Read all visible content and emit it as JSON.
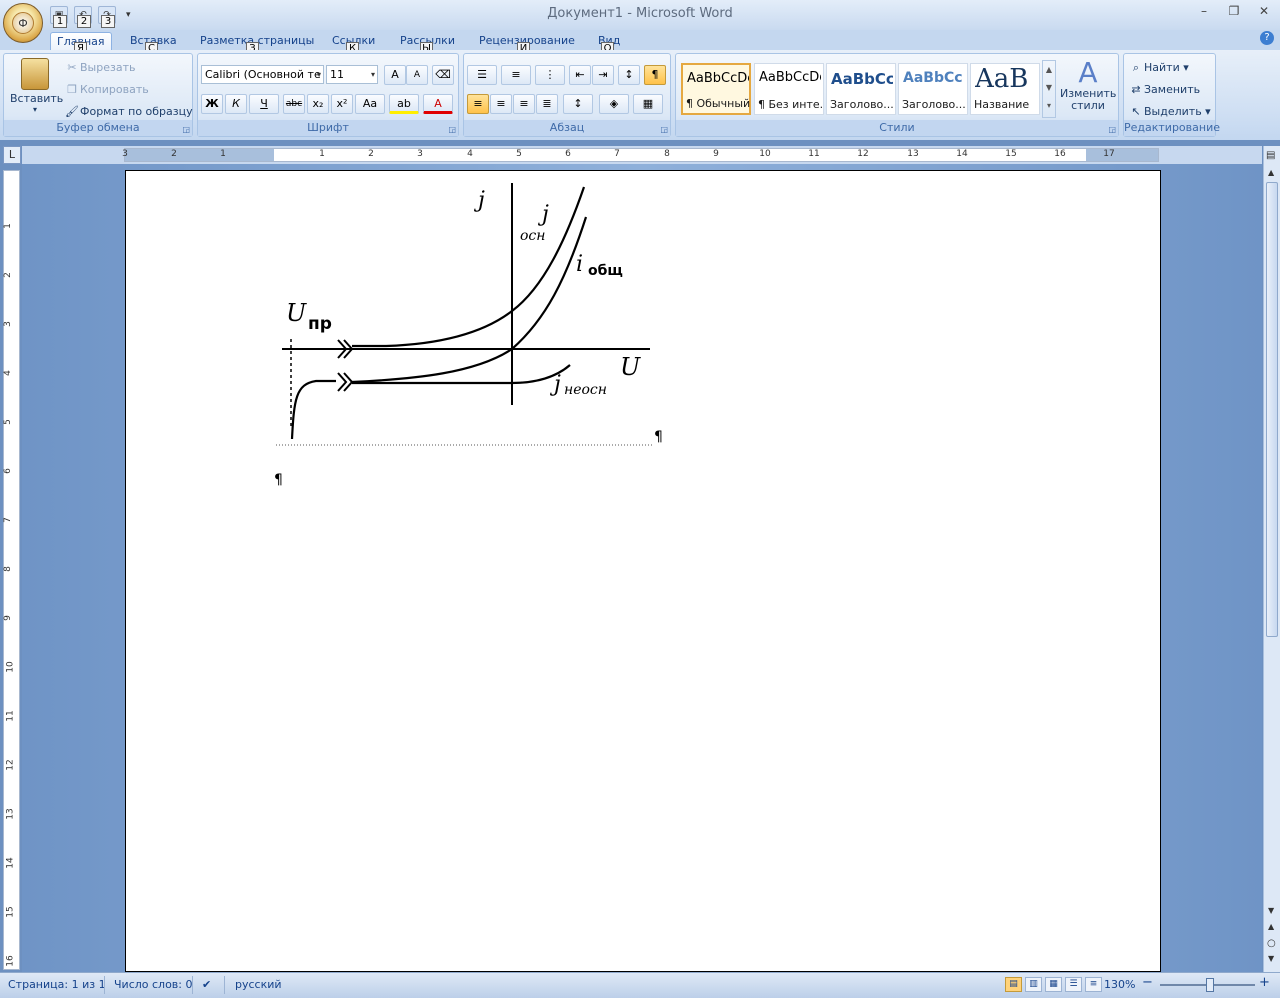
{
  "window": {
    "title": "Документ1 - Microsoft Word",
    "minimize": "–",
    "restore": "❐",
    "close": "✕"
  },
  "office_button": {
    "glyph": "Ф"
  },
  "qat": {
    "keys": [
      "1",
      "2",
      "3"
    ],
    "customize": "▾"
  },
  "tabs": [
    {
      "label": "Главная",
      "key": "Я"
    },
    {
      "label": "Вставка",
      "key": "С"
    },
    {
      "label": "Разметка страницы",
      "key": "З"
    },
    {
      "label": "Ссылки",
      "key": "К"
    },
    {
      "label": "Рассылки",
      "key": "Ы"
    },
    {
      "label": "Рецензирование",
      "key": "И"
    },
    {
      "label": "Вид",
      "key": "О"
    }
  ],
  "clipboard": {
    "title": "Буфер обмена",
    "paste": "Вставить",
    "cut": "Вырезать",
    "copy": "Копировать",
    "format_painter": "Формат по образцу"
  },
  "font": {
    "title": "Шрифт",
    "name": "Calibri (Основной те",
    "size": "11",
    "bold": "Ж",
    "italic": "К",
    "underline": "Ч",
    "strike": "abc",
    "sub": "x₂",
    "sup": "x²",
    "case": "Aa",
    "grow": "A",
    "shrink": "A"
  },
  "paragraph": {
    "title": "Абзац"
  },
  "styles": {
    "title": "Стили",
    "items": [
      {
        "sample": "AaBbCcDc",
        "label": "¶ Обычный"
      },
      {
        "sample": "AaBbCcDc",
        "label": "¶ Без инте..."
      },
      {
        "sample": "AaBbCc",
        "label": "Заголово..."
      },
      {
        "sample": "AaBbCc",
        "label": "Заголово..."
      },
      {
        "sample": "AaB",
        "label": "Название"
      }
    ],
    "change": "Изменить стили"
  },
  "editing": {
    "title": "Редактирование",
    "find": "Найти",
    "replace": "Заменить",
    "select": "Выделить"
  },
  "ruler": {
    "h_numbers": [
      "3",
      "2",
      "1",
      "1",
      "2",
      "3",
      "4",
      "5",
      "6",
      "7",
      "8",
      "9",
      "10",
      "11",
      "12",
      "13",
      "14",
      "15",
      "16",
      "17"
    ],
    "v_numbers": [
      "1",
      "2",
      "3",
      "4",
      "5",
      "6",
      "7",
      "8",
      "9",
      "10",
      "11",
      "12",
      "13",
      "14",
      "15",
      "16"
    ],
    "tab_selector": "L"
  },
  "figure": {
    "label_j": "j",
    "label_j_osn_j": "j",
    "label_osn": "осн",
    "label_i_obsh": "i",
    "label_obsh": "общ",
    "label_u_pr": "U",
    "label_pr": "пр",
    "label_u": "U",
    "label_j_neosn": "j",
    "label_neosn": "неосн"
  },
  "document": {
    "pilcrow": "¶"
  },
  "status": {
    "page": "Страница: 1 из 1",
    "words": "Число слов: 0",
    "language": "русский",
    "zoom": "130%",
    "zoom_minus": "−",
    "zoom_plus": "+"
  }
}
